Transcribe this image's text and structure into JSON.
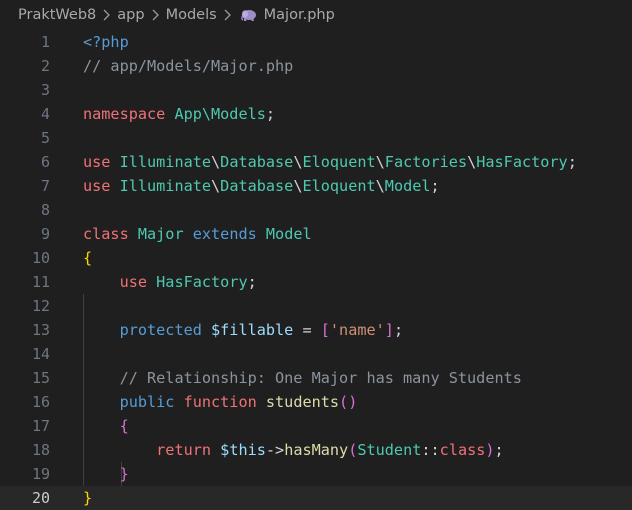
{
  "breadcrumb": {
    "project": "PraktWeb8",
    "folder1": "app",
    "folder2": "Models",
    "file": "Major.php",
    "file_icon": "php-elephant-icon"
  },
  "editor": {
    "current_line": 20,
    "line_numbers": [
      "1",
      "2",
      "3",
      "4",
      "5",
      "6",
      "7",
      "8",
      "9",
      "10",
      "11",
      "12",
      "13",
      "14",
      "15",
      "16",
      "17",
      "18",
      "19",
      "20"
    ],
    "lines": [
      [
        {
          "t": "<?php",
          "c": "k-blue"
        }
      ],
      [
        {
          "t": "// app/Models/Major.php",
          "c": "k-cm"
        }
      ],
      [],
      [
        {
          "t": "namespace ",
          "c": "k-kw"
        },
        {
          "t": "App\\Models",
          "c": "k-cls"
        },
        {
          "t": ";",
          "c": ""
        }
      ],
      [],
      [
        {
          "t": "use ",
          "c": "k-kw"
        },
        {
          "t": "Illuminate",
          "c": "k-cls"
        },
        {
          "t": "\\",
          "c": ""
        },
        {
          "t": "Database",
          "c": "k-cls"
        },
        {
          "t": "\\",
          "c": ""
        },
        {
          "t": "Eloquent",
          "c": "k-cls"
        },
        {
          "t": "\\",
          "c": ""
        },
        {
          "t": "Factories",
          "c": "k-cls"
        },
        {
          "t": "\\",
          "c": ""
        },
        {
          "t": "HasFactory",
          "c": "k-cls"
        },
        {
          "t": ";",
          "c": ""
        }
      ],
      [
        {
          "t": "use ",
          "c": "k-kw"
        },
        {
          "t": "Illuminate",
          "c": "k-cls"
        },
        {
          "t": "\\",
          "c": ""
        },
        {
          "t": "Database",
          "c": "k-cls"
        },
        {
          "t": "\\",
          "c": ""
        },
        {
          "t": "Eloquent",
          "c": "k-cls"
        },
        {
          "t": "\\",
          "c": ""
        },
        {
          "t": "Model",
          "c": "k-cls"
        },
        {
          "t": ";",
          "c": ""
        }
      ],
      [],
      [
        {
          "t": "class ",
          "c": "k-kw"
        },
        {
          "t": "Major ",
          "c": "k-cls"
        },
        {
          "t": "extends ",
          "c": "k-blue"
        },
        {
          "t": "Model",
          "c": "k-cls"
        }
      ],
      [
        {
          "t": "{",
          "c": "k-br1"
        }
      ],
      [
        {
          "t": "    ",
          "c": ""
        },
        {
          "t": "use ",
          "c": "k-kw"
        },
        {
          "t": "HasFactory",
          "c": "k-cls"
        },
        {
          "t": ";",
          "c": ""
        }
      ],
      [],
      [
        {
          "t": "    ",
          "c": ""
        },
        {
          "t": "protected ",
          "c": "k-blue"
        },
        {
          "t": "$fillable",
          "c": "k-var"
        },
        {
          "t": " = ",
          "c": ""
        },
        {
          "t": "[",
          "c": "k-br2"
        },
        {
          "t": "'name'",
          "c": "k-str"
        },
        {
          "t": "]",
          "c": "k-br2"
        },
        {
          "t": ";",
          "c": ""
        }
      ],
      [],
      [
        {
          "t": "    ",
          "c": ""
        },
        {
          "t": "// Relationship: One Major has many Students",
          "c": "k-cm"
        }
      ],
      [
        {
          "t": "    ",
          "c": ""
        },
        {
          "t": "public ",
          "c": "k-blue"
        },
        {
          "t": "function ",
          "c": "k-kw"
        },
        {
          "t": "students",
          "c": "k-fn"
        },
        {
          "t": "()",
          "c": "k-br2"
        }
      ],
      [
        {
          "t": "    ",
          "c": ""
        },
        {
          "t": "{",
          "c": "k-br2"
        }
      ],
      [
        {
          "t": "        ",
          "c": ""
        },
        {
          "t": "return ",
          "c": "k-kw"
        },
        {
          "t": "$this",
          "c": "k-var"
        },
        {
          "t": "->",
          "c": ""
        },
        {
          "t": "hasMany",
          "c": "k-fn"
        },
        {
          "t": "(",
          "c": "k-br2"
        },
        {
          "t": "Student",
          "c": "k-cls"
        },
        {
          "t": "::",
          "c": ""
        },
        {
          "t": "class",
          "c": "k-kw"
        },
        {
          "t": ")",
          "c": "k-br2"
        },
        {
          "t": ";",
          "c": ""
        }
      ],
      [
        {
          "t": "    ",
          "c": ""
        },
        {
          "t": "}",
          "c": "k-br2"
        }
      ],
      [
        {
          "t": "}",
          "c": "k-br1"
        }
      ]
    ]
  }
}
